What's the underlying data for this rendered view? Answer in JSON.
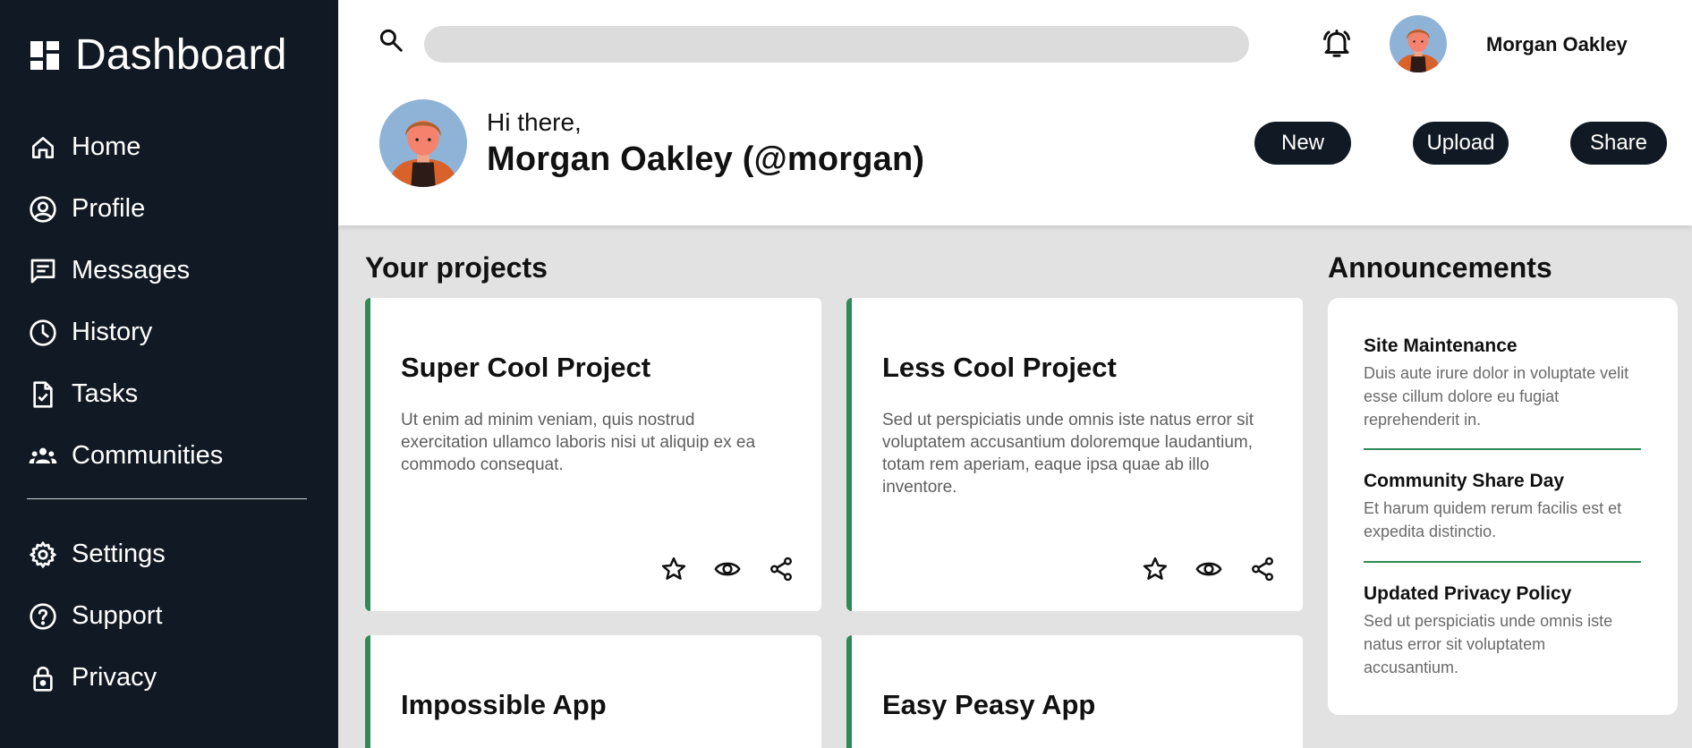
{
  "sidebar": {
    "brand": "Dashboard",
    "items": [
      {
        "label": "Home",
        "icon": "home-icon"
      },
      {
        "label": "Profile",
        "icon": "profile-icon"
      },
      {
        "label": "Messages",
        "icon": "messages-icon"
      },
      {
        "label": "History",
        "icon": "history-icon"
      },
      {
        "label": "Tasks",
        "icon": "tasks-icon"
      },
      {
        "label": "Communities",
        "icon": "communities-icon"
      }
    ],
    "secondary": [
      {
        "label": "Settings",
        "icon": "gear-icon"
      },
      {
        "label": "Support",
        "icon": "help-icon"
      },
      {
        "label": "Privacy",
        "icon": "lock-icon"
      }
    ]
  },
  "header": {
    "search_placeholder": "",
    "user_name": "Morgan Oakley",
    "greeting": "Hi there,",
    "full_name": "Morgan Oakley (@morgan)",
    "buttons": {
      "new": "New",
      "upload": "Upload",
      "share": "Share"
    }
  },
  "projects": {
    "title": "Your projects",
    "items": [
      {
        "title": "Super Cool Project",
        "description": "Ut enim ad minim veniam, quis nostrud exercitation ullamco laboris nisi ut aliquip ex ea commodo consequat."
      },
      {
        "title": "Less Cool Project",
        "description": "Sed ut perspiciatis unde omnis iste natus error sit voluptatem accusantium doloremque laudantium, totam rem aperiam, eaque ipsa quae ab illo inventore."
      },
      {
        "title": "Impossible App",
        "description": ""
      },
      {
        "title": "Easy Peasy App",
        "description": ""
      }
    ]
  },
  "announcements": {
    "title": "Announcements",
    "items": [
      {
        "title": "Site Maintenance",
        "text": "Duis aute irure dolor in voluptate velit esse cillum dolore eu fugiat reprehenderit in."
      },
      {
        "title": "Community Share Day",
        "text": "Et harum quidem rerum facilis est et expedita distinctio."
      },
      {
        "title": "Updated Privacy Policy",
        "text": "Sed ut perspiciatis unde omnis iste natus error sit voluptatem accusantium."
      }
    ]
  },
  "colors": {
    "sidebar_bg": "#111a24",
    "accent": "#2e8b57",
    "page_bg": "#e2e2e2"
  }
}
